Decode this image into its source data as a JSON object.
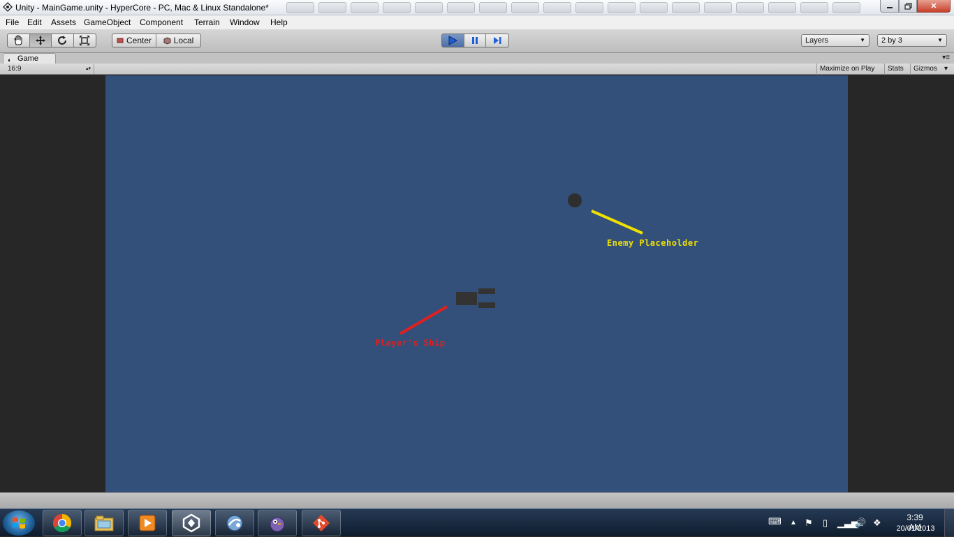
{
  "window": {
    "title": "Unity - MainGame.unity - HyperCore - PC, Mac & Linux Standalone*",
    "minimize_icon": "minimize-icon",
    "maximize_icon": "maximize-icon",
    "close_symbol": "✕"
  },
  "menu": {
    "items": [
      "File",
      "Edit",
      "Assets",
      "GameObject",
      "Component",
      "Terrain",
      "Window",
      "Help"
    ]
  },
  "toolbar": {
    "transform_tools": [
      "hand-icon",
      "move-icon",
      "rotate-icon",
      "scale-icon"
    ],
    "pivot_mode_label": "Center",
    "pivot_rotation_label": "Local",
    "playback": [
      "play-icon",
      "pause-icon",
      "step-icon"
    ],
    "layers_label": "Layers",
    "layout_label": "2 by 3"
  },
  "game_panel": {
    "tab_label": "Game",
    "aspect_ratio": "16:9",
    "maximize_on_play_label": "Maximize on Play",
    "stats_label": "Stats",
    "gizmos_label": "Gizmos"
  },
  "scene": {
    "background_color": "#325079",
    "enemy_label": "Enemy Placeholder",
    "enemy_label_color": "#f0e000",
    "ship_label": "Player's Ship",
    "ship_label_color": "#e02020"
  },
  "taskbar": {
    "apps": [
      "chrome-icon",
      "file-explorer-icon",
      "media-player-icon",
      "unity-icon",
      "remote-app-icon",
      "pidgin-icon",
      "git-icon"
    ],
    "active_app": "unity-icon",
    "clock_time": "3:39 AM",
    "clock_date": "20/01/2013"
  }
}
